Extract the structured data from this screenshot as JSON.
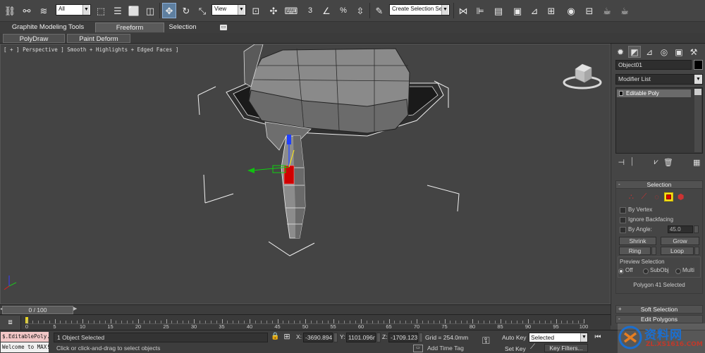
{
  "toolbar": {
    "filter_value": "All",
    "refcoord_value": "View",
    "named_selection_placeholder": "Create Selection Se",
    "snap_label": "3",
    "angle_snap_label": "n",
    "percent_snap_label": "%"
  },
  "ribbon": {
    "tabs": [
      "Graphite Modeling Tools",
      "Freeform",
      "Selection"
    ],
    "active_tab": "Freeform",
    "sub_tabs": [
      "PolyDraw",
      "Paint Deform"
    ]
  },
  "viewport": {
    "label": "[ + ] Perspective ] Smooth + Highlights + Edged Faces ]",
    "axis_x_label": "x",
    "axis_y_label": "y",
    "axis_z_label": "z"
  },
  "command_panel": {
    "object_name": "Object01",
    "modifier_list": "Modifier List",
    "stack_item": "Editable Poly",
    "selection": {
      "title": "Selection",
      "by_vertex": "By Vertex",
      "ignore_backfacing": "Ignore Backfacing",
      "by_angle": "By Angle:",
      "angle_value": "45.0",
      "shrink": "Shrink",
      "grow": "Grow",
      "ring": "Ring",
      "loop": "Loop",
      "preview_title": "Preview Selection",
      "preview_off": "Off",
      "preview_subobj": "SubObj",
      "preview_multi": "Multi",
      "status": "Polygon 41 Selected"
    },
    "soft_selection": "Soft Selection",
    "edit_polygons": "Edit Polygons",
    "rollout_sign": "+",
    "rollout_sign_open": "-"
  },
  "timeline": {
    "frame_display": "0 / 100",
    "ticks": [
      "0",
      "5",
      "10",
      "15",
      "20",
      "25",
      "30",
      "35",
      "40",
      "45",
      "50",
      "55",
      "60",
      "65",
      "70",
      "75",
      "80",
      "85",
      "90",
      "95",
      "100"
    ]
  },
  "status": {
    "listener_top": "$.EditablePoly.",
    "listener_bottom": "Welcome to MAX!",
    "selection_info": "1 Object Selected",
    "prompt": "Click or click-and-drag to select objects",
    "x_label": "X:",
    "x_value": "-3690.894",
    "y_label": "Y:",
    "y_value": "1101.096m",
    "z_label": "Z:",
    "z_value": "-1709.123t",
    "grid": "Grid = 254.0mm",
    "add_time_tag": "Add Time Tag",
    "auto_key": "Auto Key",
    "set_key": "Set Key",
    "selected_dropdown": "Selected",
    "key_filters": "Key Filters..."
  },
  "watermark": {
    "title": "资料网",
    "url": "ZL.XS1616.COM"
  },
  "colors": {
    "viewport_bg": "#444444",
    "active_subobject": "#f7e21a",
    "selected_polygon": "#d00000",
    "watermark_blue": "#1b6fd0"
  }
}
